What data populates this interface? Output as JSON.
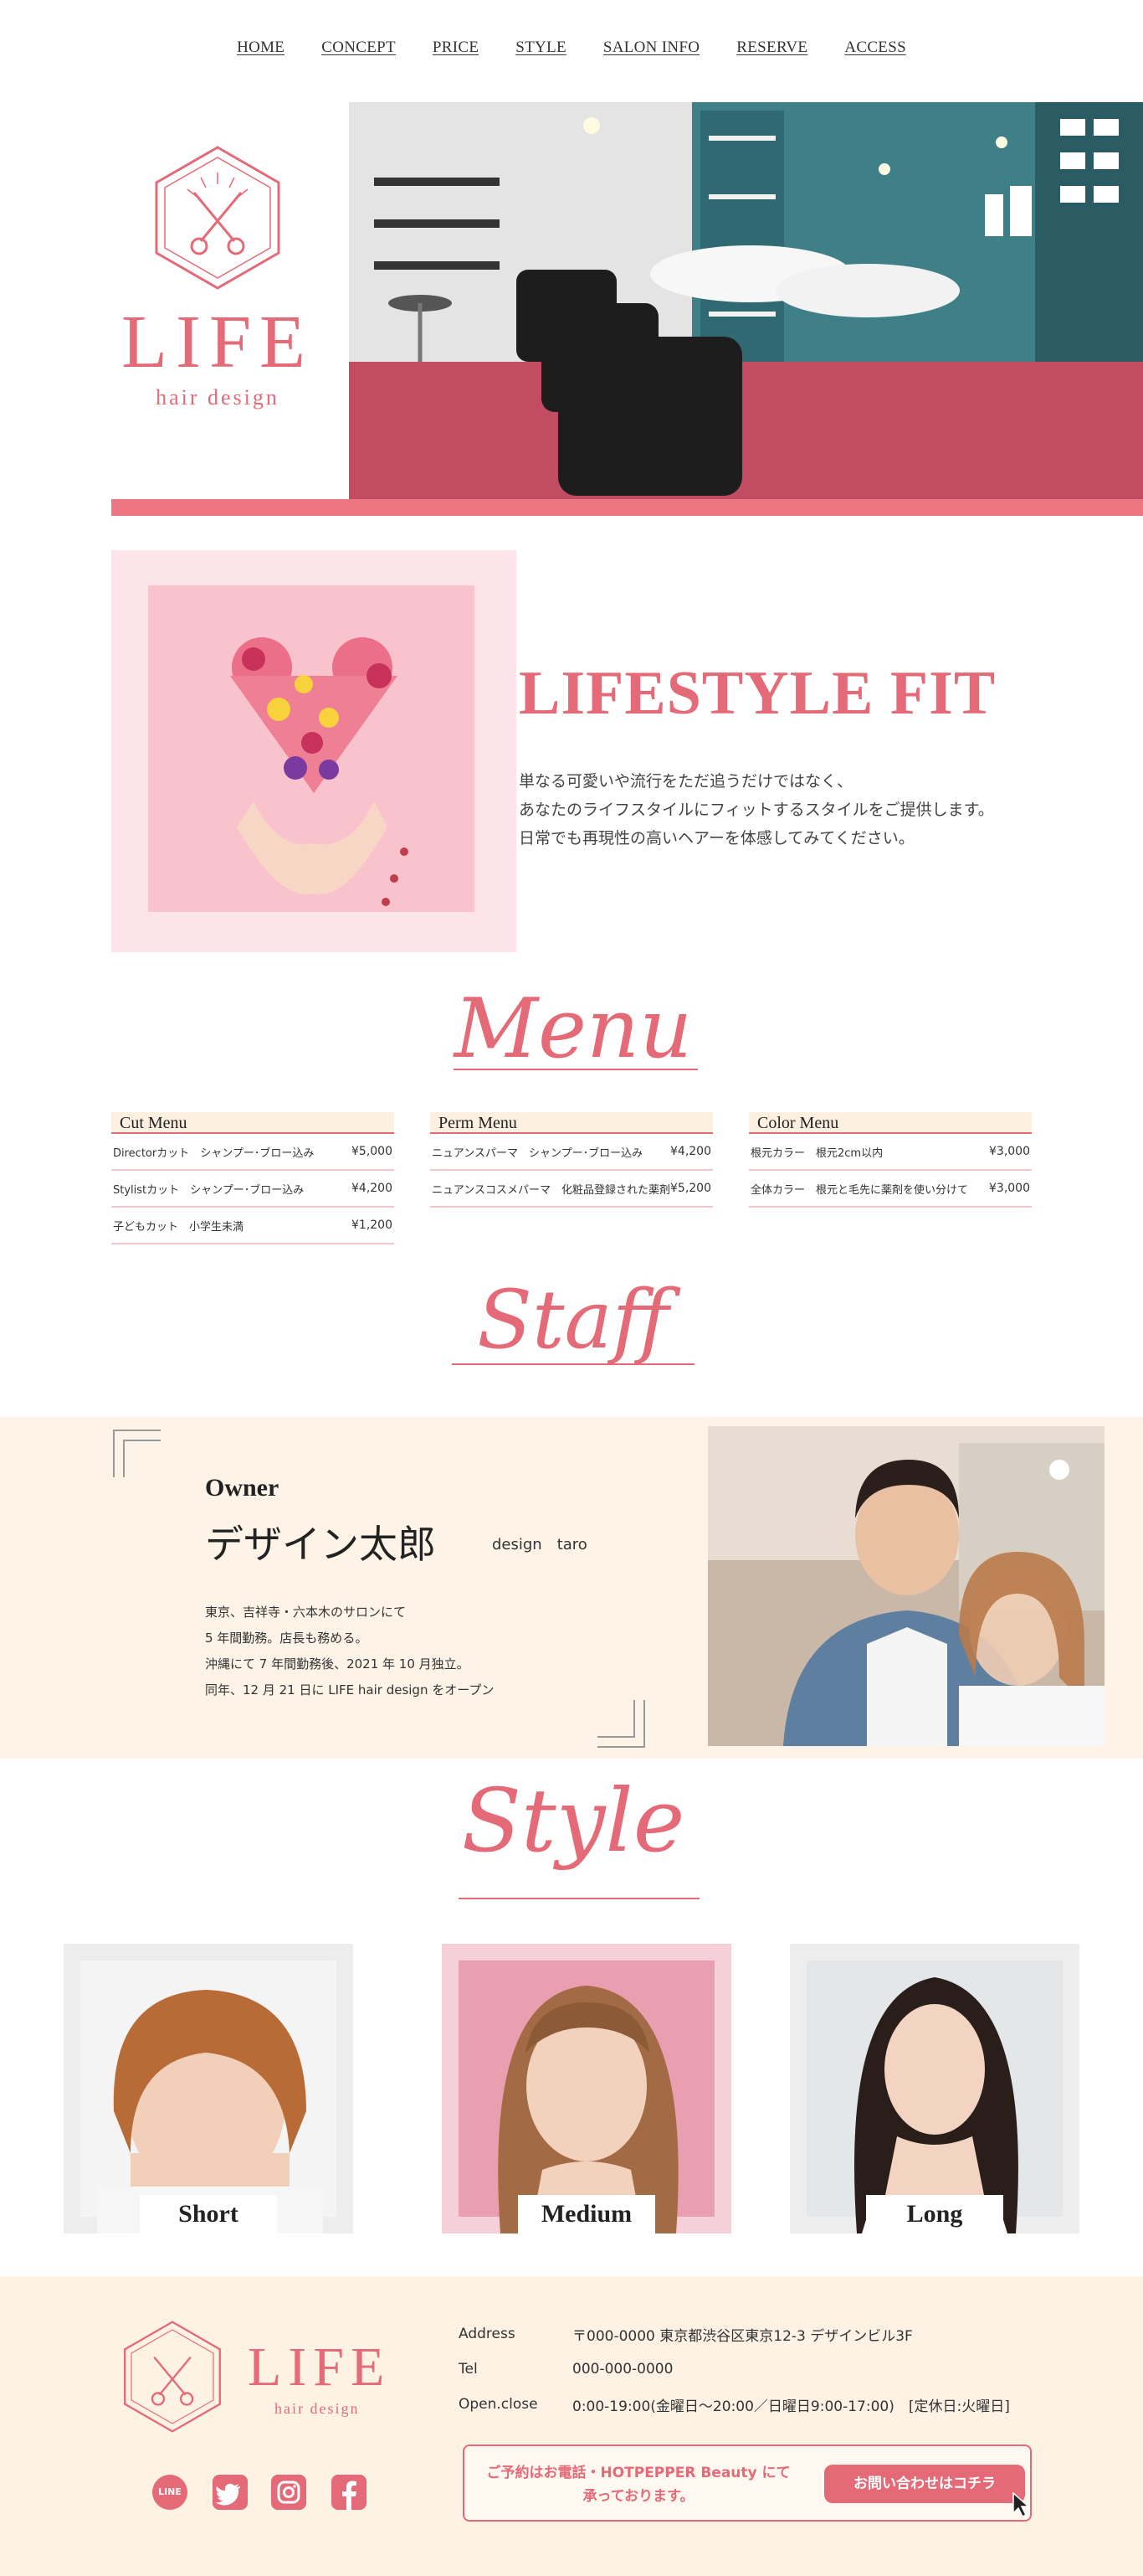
{
  "nav": {
    "items": [
      "HOME",
      "CONCEPT",
      "PRICE",
      "STYLE",
      "SALON INFO",
      "RESERVE",
      "ACCESS"
    ]
  },
  "brand": {
    "name": "LIFE",
    "tagline": "hair design",
    "accent_color": "#e56a77"
  },
  "concept": {
    "title": "LIFESTYLE FIT",
    "lines": [
      "単なる可愛いや流行をただ追うだけではなく、",
      "あなたのライフスタイルにフィットするスタイルをご提供します。",
      "日常でも再現性の高いヘアーを体感してみてください。"
    ]
  },
  "menu": {
    "title": "Menu",
    "columns": [
      {
        "heading": "Cut Menu",
        "rows": [
          {
            "name": "Directorカット　シャンプー･ブロー込み",
            "price": "¥5,000"
          },
          {
            "name": "Stylistカット　シャンプー･ブロー込み",
            "price": "¥4,200"
          },
          {
            "name": "子どもカット　小学生未満",
            "price": "¥1,200"
          }
        ]
      },
      {
        "heading": "Perm Menu",
        "rows": [
          {
            "name": "ニュアンスパーマ　シャンプー･ブロー込み",
            "price": "¥4,200"
          },
          {
            "name": "ニュアンスコスメパーマ　化粧品登録された薬剤",
            "price": "¥5,200"
          }
        ]
      },
      {
        "heading": "Color Menu",
        "rows": [
          {
            "name": "根元カラー　根元2cm以内",
            "price": "¥3,000"
          },
          {
            "name": "全体カラー　根元と毛先に薬剤を使い分けて",
            "price": "¥3,000"
          }
        ]
      }
    ]
  },
  "staff": {
    "title": "Staff",
    "role": "Owner",
    "name_jp": "デザイン太郎",
    "name_en": "design　taro",
    "bio": [
      "東京、吉祥寺・六本木のサロンにて",
      "5 年間勤務。店長も務める。",
      "沖縄にて 7 年間勤務後、2021 年 10 月独立。",
      "同年、12 月 21 日に LIFE hair design をオープン"
    ]
  },
  "style": {
    "title": "Style",
    "cards": [
      {
        "label": "Short"
      },
      {
        "label": "Medium"
      },
      {
        "label": "Long"
      }
    ]
  },
  "footer": {
    "brand": "LIFE",
    "tagline": "hair design",
    "address_label": "Address",
    "address_value": "〒000-0000  東京都渋谷区東京12-3 デザインビル3F",
    "tel_label": "Tel",
    "tel_value": "000-000-0000",
    "hours_label": "Open.close",
    "hours_value": "0:00-19:00(金曜日〜20:00／日曜日9:00-17:00)　[定休日:火曜日]",
    "contact_line1": "ご予約はお電話・HOTPEPPER Beauty にて",
    "contact_line2": "承っております。",
    "contact_button": "お問い合わせはコチラ",
    "social": [
      "LINE",
      "Twitter",
      "Instagram",
      "Facebook"
    ]
  }
}
